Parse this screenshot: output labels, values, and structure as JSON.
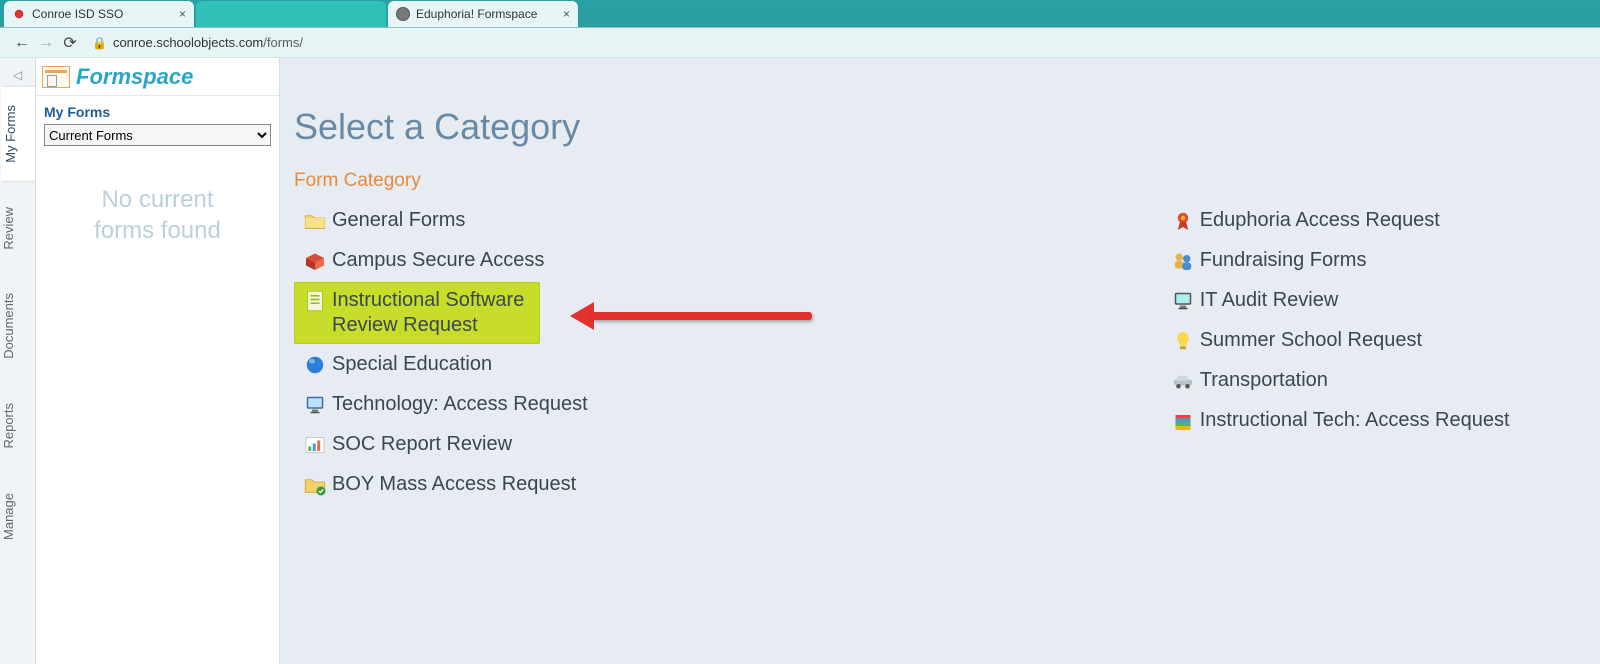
{
  "browser": {
    "tabs": [
      {
        "title": "Conroe ISD SSO",
        "active": false,
        "faviconColor": "#d33"
      },
      {
        "title": "",
        "active": false,
        "faviconColor": "#2fc1b7",
        "blank": true
      },
      {
        "title": "Eduphoria! Formspace",
        "active": true,
        "faviconColor": "#666"
      }
    ],
    "url_display": "conroe.schoolobjects.com/forms/",
    "url_domain": "conroe.schoolobjects.com",
    "url_path": "/forms/"
  },
  "brand": "Formspace",
  "sideTabs": [
    "My Forms",
    "Review",
    "Documents",
    "Reports",
    "Manage"
  ],
  "sideTabActive": 0,
  "leftPane": {
    "heading": "My Forms",
    "selectValue": "Current Forms",
    "emptyLine1": "No current",
    "emptyLine2": "forms found"
  },
  "main": {
    "title": "Select a Category",
    "sectionTitle": "Form Category",
    "columns": [
      [
        {
          "label": "General Forms",
          "icon": "folder"
        },
        {
          "label": "Campus Secure Access",
          "icon": "box-red"
        },
        {
          "label": "Instructional Software Review Request",
          "icon": "doc-green",
          "highlight": true
        },
        {
          "label": "Special Education",
          "icon": "sphere-blue"
        },
        {
          "label": "Technology: Access Request",
          "icon": "monitor"
        },
        {
          "label": "SOC Report Review",
          "icon": "chart"
        },
        {
          "label": "BOY Mass Access Request",
          "icon": "folder-check"
        }
      ],
      [
        {
          "label": "Eduphoria Access Request",
          "icon": "ribbon"
        },
        {
          "label": "Fundraising Forms",
          "icon": "people"
        },
        {
          "label": "IT Audit Review",
          "icon": "monitor2"
        },
        {
          "label": "Summer School Request",
          "icon": "bulb"
        },
        {
          "label": "Transportation",
          "icon": "car"
        },
        {
          "label": "Instructional Tech: Access Request",
          "icon": "books"
        }
      ]
    ]
  }
}
